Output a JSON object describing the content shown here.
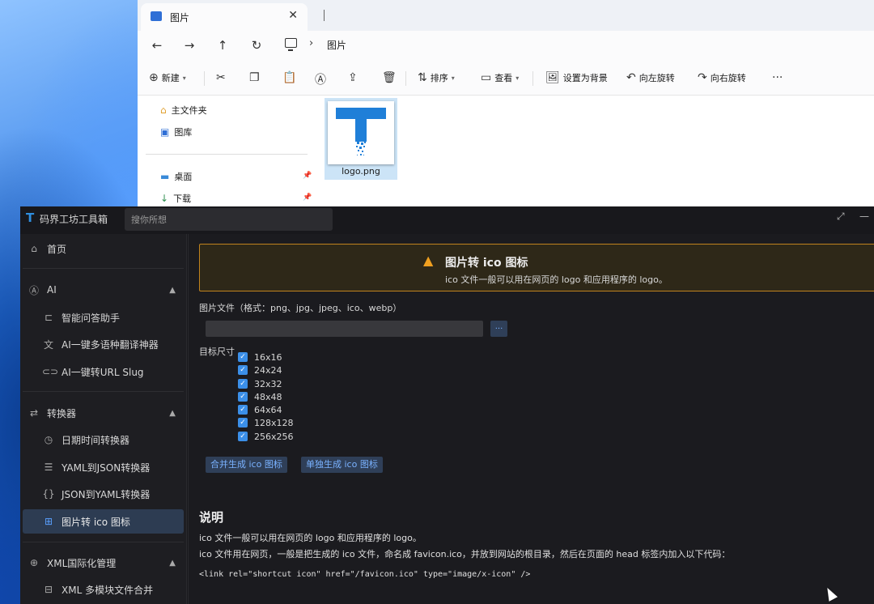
{
  "explorer": {
    "tab_title": "图片",
    "address": "图片",
    "commands": {
      "new": "新建",
      "sort": "排序",
      "view": "查看",
      "set_bg": "设置为背景",
      "rotate_left": "向左旋转",
      "rotate_right": "向右旋转",
      "more": "···"
    },
    "sidebar": {
      "home": "主文件夹",
      "gallery": "图库",
      "desktop": "桌面",
      "downloads": "下载"
    },
    "file": {
      "name": "logo.png"
    }
  },
  "app": {
    "logo": "T",
    "name": "码界工坊工具箱",
    "search_placeholder": "搜你所想",
    "sidebar": {
      "home": "首页",
      "ai_group": "AI",
      "ai_items": [
        "智能问答助手",
        "AI一键多语种翻译神器",
        "AI一键转URL Slug"
      ],
      "conv_group": "转换器",
      "conv_items": [
        "日期时间转换器",
        "YAML到JSON转换器",
        "JSON到YAML转换器",
        "图片转 ico 图标"
      ],
      "xml_group": "XML国际化管理",
      "xml_items": [
        "XML 多模块文件合并"
      ]
    },
    "main": {
      "banner_title": "图片转 ico 图标",
      "banner_sub": "ico 文件一般可以用在网页的 logo 和应用程序的 logo。",
      "file_label": "图片文件（格式：png、jpg、jpeg、ico、webp）",
      "browse": "...",
      "size_label": "目标尺寸",
      "sizes": [
        "16x16",
        "24x24",
        "32x32",
        "48x48",
        "64x64",
        "128x128",
        "256x256"
      ],
      "btn_merge": "合并生成 ico 图标",
      "btn_single": "单独生成 ico 图标",
      "desc_title": "说明",
      "desc_line1": "ico 文件一般可以用在网页的 logo 和应用程序的 logo。",
      "desc_line2": "ico 文件用在网页，一般是把生成的 ico 文件，命名成 favicon.ico，并放到网站的根目录，然后在页面的 head 标签内加入以下代码：",
      "code": "<link rel=\"shortcut icon\" href=\"/favicon.ico\" type=\"image/x-icon\" />"
    }
  }
}
